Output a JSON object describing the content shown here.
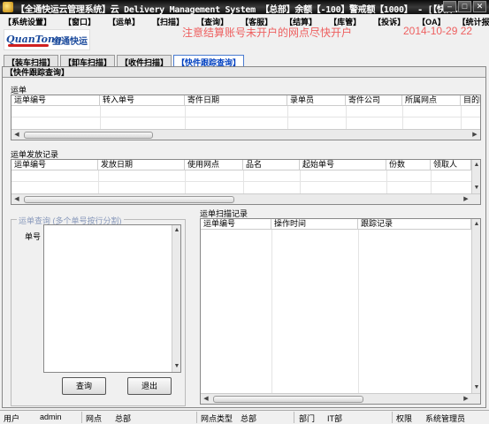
{
  "window": {
    "title": "【全通快运云管理系统】云 Delivery Management System 【总部】余额【-100】警戒额【1000】 - [【快件...",
    "minimize": "–",
    "maximize": "□",
    "close": "✕"
  },
  "menu": [
    "【系统设置】",
    "【窗口】",
    "【运单】",
    "【扫描】",
    "【查询】",
    "【客服】",
    "【结算】",
    "【库管】",
    "【投诉】",
    "【OA】",
    "【统计报表】"
  ],
  "logo": {
    "en": "QuanTong",
    "cn": "全通快运"
  },
  "marquee": {
    "text": "注意结算账号未开户的网点尽快开户",
    "date": "2014-10-29 22"
  },
  "tabs": [
    "【装车扫描】",
    "【卸车扫描】",
    "【收件扫描】",
    "【快件跟踪查询】"
  ],
  "frame_title": "【快件跟踪查询】",
  "waybill": {
    "label": "运单",
    "columns": [
      "运单编号",
      "转入单号",
      "寄件日期",
      "录单员",
      "寄件公司",
      "所属网点",
      "目的网"
    ]
  },
  "dispatch": {
    "label": "运单发放记录",
    "columns": [
      "运单编号",
      "发放日期",
      "使用网点",
      "品名",
      "起始单号",
      "份数",
      "领取人"
    ]
  },
  "query": {
    "legend": "运单查询 (多个单号按行分割)",
    "field_label": "单号",
    "query_button": "查询",
    "exit_button": "退出"
  },
  "scan": {
    "label": "运单扫描记录",
    "columns": [
      "运单编号",
      "操作时间",
      "跟踪记录"
    ]
  },
  "status": {
    "user_label": "用户",
    "user_value": "admin",
    "site_label": "网点",
    "site_value": "总部",
    "site_type_label": "网点类型",
    "site_type_value": "总部",
    "dept_label": "部门",
    "dept_value": "IT部",
    "perm_label": "权限",
    "perm_value": "系统管理员"
  }
}
